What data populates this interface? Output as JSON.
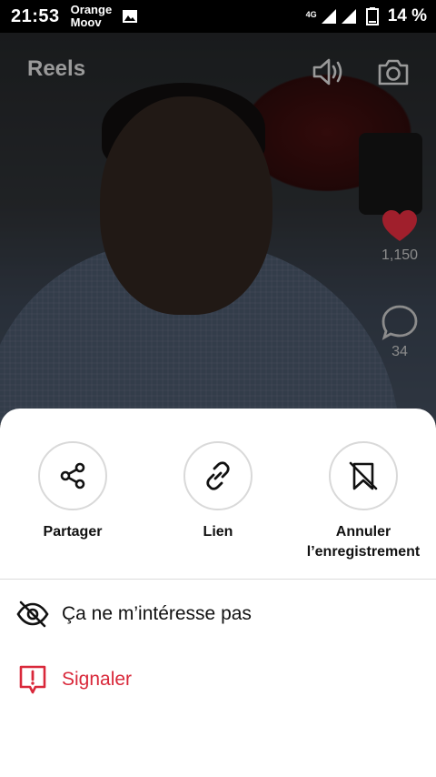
{
  "status_bar": {
    "time": "21:53",
    "carrier_line1": "Orange",
    "carrier_line2": "Moov",
    "network": "4G",
    "battery": "14 %"
  },
  "header": {
    "title": "Reels",
    "icons": [
      "speaker-icon",
      "camera-icon"
    ]
  },
  "rail": {
    "likes": "1,150",
    "comments": "34"
  },
  "sheet": {
    "actions": [
      {
        "label": "Partager",
        "icon": "share-icon"
      },
      {
        "label": "Lien",
        "icon": "link-icon"
      },
      {
        "label_line1": "Annuler",
        "label_line2": "l’enregistrement",
        "icon": "bookmark-off-icon"
      }
    ],
    "not_interested": "Ça ne m’intéresse pas",
    "report": "Signaler"
  },
  "colors": {
    "like_red": "#e0253b",
    "report_red": "#d9283a",
    "text": "#111111"
  }
}
